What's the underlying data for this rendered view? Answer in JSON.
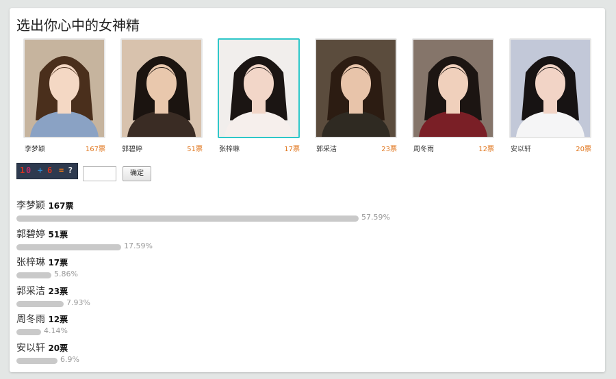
{
  "poll": {
    "title": "选出你心中的女神精",
    "vote_suffix": "票",
    "candidates": [
      {
        "name": "李梦颖",
        "votes_label": "167票",
        "selected": false,
        "bg": "#c6b49e",
        "hair": "#4a2f1c",
        "skin": "#f4d8c4",
        "top": "#8aa2c4"
      },
      {
        "name": "郭碧婷",
        "votes_label": "51票",
        "selected": false,
        "bg": "#d8c2ad",
        "hair": "#1b1410",
        "skin": "#e9c8ad",
        "top": "#3a2c24"
      },
      {
        "name": "张梓琳",
        "votes_label": "17票",
        "selected": true,
        "bg": "#f1eeec",
        "hair": "#1b1513",
        "skin": "#f2d6c8",
        "top": "#f6efec"
      },
      {
        "name": "郭采洁",
        "votes_label": "23票",
        "selected": false,
        "bg": "#5b4c3d",
        "hair": "#2c1c12",
        "skin": "#e8c4aa",
        "top": "#2f2a22"
      },
      {
        "name": "周冬雨",
        "votes_label": "12票",
        "selected": false,
        "bg": "#85756a",
        "hair": "#1c1512",
        "skin": "#f0d0bc",
        "top": "#7a1f26"
      },
      {
        "name": "安以轩",
        "votes_label": "20票",
        "selected": false,
        "bg": "#c2c8d8",
        "hair": "#171313",
        "skin": "#f2d4c6",
        "top": "#f5f5f6"
      }
    ],
    "captcha": {
      "chars": [
        {
          "t": "1",
          "c": "#d8341e"
        },
        {
          "t": "0",
          "c": "#c42b66"
        },
        {
          "t": "+",
          "c": "#2c8bd4"
        },
        {
          "t": "6",
          "c": "#d8341e"
        },
        {
          "t": "=",
          "c": "#e0741a"
        },
        {
          "t": "?",
          "c": "#f0f0f0"
        }
      ]
    },
    "answer_value": "",
    "submit_label": "确定",
    "results": [
      {
        "name": "李梦颖",
        "votes": "167票",
        "percent_label": "57.59%",
        "percent": 57.59
      },
      {
        "name": "郭碧婷",
        "votes": "51票",
        "percent_label": "17.59%",
        "percent": 17.59
      },
      {
        "name": "张梓琳",
        "votes": "17票",
        "percent_label": "5.86%",
        "percent": 5.86
      },
      {
        "name": "郭采洁",
        "votes": "23票",
        "percent_label": "7.93%",
        "percent": 7.93
      },
      {
        "name": "周冬雨",
        "votes": "12票",
        "percent_label": "4.14%",
        "percent": 4.14
      },
      {
        "name": "安以轩",
        "votes": "20票",
        "percent_label": "6.9%",
        "percent": 6.9
      }
    ]
  }
}
